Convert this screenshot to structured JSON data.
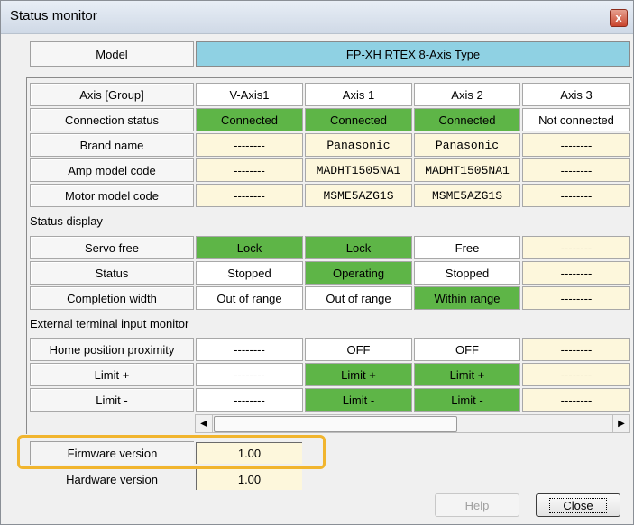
{
  "window": {
    "title": "Status monitor",
    "close_glyph": "x"
  },
  "model": {
    "label": "Model",
    "value": "FP-XH RTEX 8-Axis Type"
  },
  "table": {
    "axis_header": "Axis [Group]",
    "columns": [
      "V-Axis1",
      "Axis 1",
      "Axis 2",
      "Axis 3"
    ],
    "top_rows": [
      {
        "label": "Connection status",
        "cells": [
          {
            "text": "Connected",
            "style": "green"
          },
          {
            "text": "Connected",
            "style": "green"
          },
          {
            "text": "Connected",
            "style": "green"
          },
          {
            "text": "Not connected",
            "style": "white"
          }
        ]
      },
      {
        "label": "Brand name",
        "cells": [
          {
            "text": "--------",
            "style": "yellow"
          },
          {
            "text": "Panasonic",
            "style": "yellow",
            "mono": true
          },
          {
            "text": "Panasonic",
            "style": "yellow",
            "mono": true
          },
          {
            "text": "--------",
            "style": "yellow"
          }
        ]
      },
      {
        "label": "Amp model code",
        "cells": [
          {
            "text": "--------",
            "style": "yellow"
          },
          {
            "text": "MADHT1505NA1",
            "style": "yellow",
            "mono": true
          },
          {
            "text": "MADHT1505NA1",
            "style": "yellow",
            "mono": true
          },
          {
            "text": "--------",
            "style": "yellow"
          }
        ]
      },
      {
        "label": "Motor model code",
        "cells": [
          {
            "text": "--------",
            "style": "yellow"
          },
          {
            "text": "MSME5AZG1S",
            "style": "yellow",
            "mono": true
          },
          {
            "text": "MSME5AZG1S",
            "style": "yellow",
            "mono": true
          },
          {
            "text": "--------",
            "style": "yellow"
          }
        ]
      }
    ],
    "status_section": "Status display",
    "status_rows": [
      {
        "label": "Servo free",
        "cells": [
          {
            "text": "Lock",
            "style": "green"
          },
          {
            "text": "Lock",
            "style": "green"
          },
          {
            "text": "Free",
            "style": "white"
          },
          {
            "text": "--------",
            "style": "yellow"
          }
        ]
      },
      {
        "label": "Status",
        "cells": [
          {
            "text": "Stopped",
            "style": "white"
          },
          {
            "text": "Operating",
            "style": "green"
          },
          {
            "text": "Stopped",
            "style": "white"
          },
          {
            "text": "--------",
            "style": "yellow"
          }
        ]
      },
      {
        "label": "Completion width",
        "cells": [
          {
            "text": "Out of range",
            "style": "white"
          },
          {
            "text": "Out of range",
            "style": "white"
          },
          {
            "text": "Within range",
            "style": "green"
          },
          {
            "text": "--------",
            "style": "yellow"
          }
        ]
      }
    ],
    "input_section": "External terminal input monitor",
    "input_rows": [
      {
        "label": "Home position proximity",
        "cells": [
          {
            "text": "--------",
            "style": "white"
          },
          {
            "text": "OFF",
            "style": "white"
          },
          {
            "text": "OFF",
            "style": "white"
          },
          {
            "text": "--------",
            "style": "yellow"
          }
        ]
      },
      {
        "label": "Limit +",
        "cells": [
          {
            "text": "--------",
            "style": "white"
          },
          {
            "text": "Limit +",
            "style": "green"
          },
          {
            "text": "Limit +",
            "style": "green"
          },
          {
            "text": "--------",
            "style": "yellow"
          }
        ]
      },
      {
        "label": "Limit -",
        "cells": [
          {
            "text": "--------",
            "style": "white"
          },
          {
            "text": "Limit -",
            "style": "green"
          },
          {
            "text": "Limit -",
            "style": "green"
          },
          {
            "text": "--------",
            "style": "yellow"
          }
        ]
      }
    ]
  },
  "scrollbar": {
    "left_glyph": "◀",
    "right_glyph": "▶"
  },
  "firmware": {
    "label": "Firmware version",
    "value": "1.00"
  },
  "hardware": {
    "label": "Hardware version",
    "value": "1.00"
  },
  "buttons": {
    "help": "Help",
    "close": "Close"
  },
  "colors": {
    "connected_green": "#5eb547",
    "model_blue": "#8fd1e3",
    "highlight": "#f1b52e"
  }
}
